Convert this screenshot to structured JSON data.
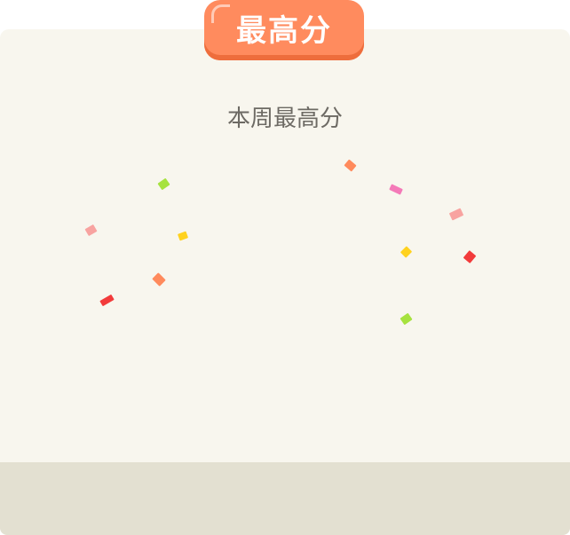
{
  "badge": {
    "label": "最高分"
  },
  "subtitle": "本周最高分",
  "colors": {
    "panel_background": "#f8f6ee",
    "panel_footer": "#e3e0d1",
    "badge_fill": "#ff8b5e",
    "badge_shadow": "#ee6d3c",
    "subtitle_text": "#6d6a64"
  },
  "confetti_colors": {
    "green": "#a6e23e",
    "orange": "#ff8a5c",
    "pink": "#f47ab8",
    "salmon": "#f8a3a0",
    "yellow": "#ffd21f",
    "red": "#f23b3b"
  }
}
